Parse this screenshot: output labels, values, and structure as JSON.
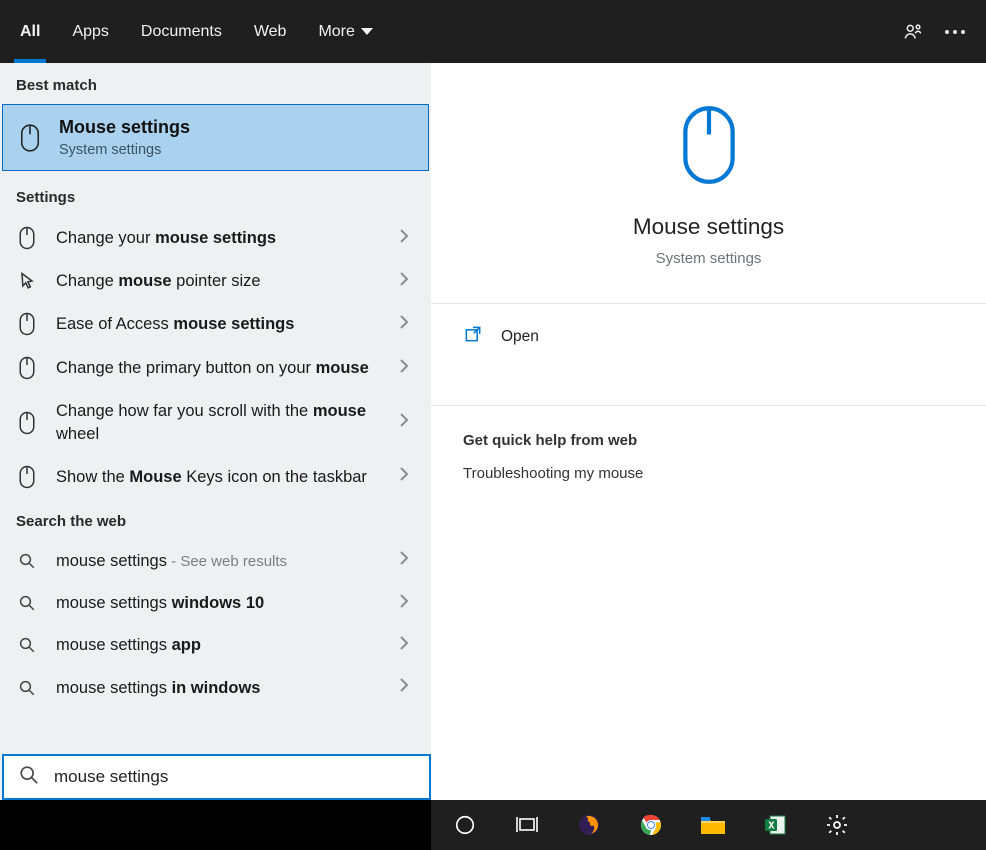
{
  "tabs": {
    "all": "All",
    "apps": "Apps",
    "documents": "Documents",
    "web": "Web",
    "more": "More"
  },
  "sections": {
    "best_match": "Best match",
    "settings": "Settings",
    "search_web": "Search the web"
  },
  "best_match": {
    "title": "Mouse settings",
    "subtitle": "System settings"
  },
  "settings_results": [
    {
      "pre": "Change your ",
      "bold": "mouse settings",
      "post": "",
      "icon": "mouse"
    },
    {
      "pre": "Change ",
      "bold": "mouse",
      "post": " pointer size",
      "icon": "pointer"
    },
    {
      "pre": "Ease of Access ",
      "bold": "mouse settings",
      "post": "",
      "icon": "mouse"
    },
    {
      "pre": "Change the primary button on your ",
      "bold": "mouse",
      "post": "",
      "icon": "mouse"
    },
    {
      "pre": "Change how far you scroll with the ",
      "bold": "mouse",
      "post": " wheel",
      "icon": "mouse"
    },
    {
      "pre": "Show the ",
      "bold": "Mouse",
      "post": " Keys icon on the taskbar",
      "icon": "mouse"
    }
  ],
  "web_results": [
    {
      "pre": "mouse settings",
      "bold": "",
      "post": "",
      "suffix": " - See web results"
    },
    {
      "pre": "mouse settings ",
      "bold": "windows 10",
      "post": ""
    },
    {
      "pre": "mouse settings ",
      "bold": "app",
      "post": ""
    },
    {
      "pre": "mouse settings ",
      "bold": "in windows",
      "post": ""
    }
  ],
  "preview": {
    "title": "Mouse settings",
    "subtitle": "System settings",
    "open": "Open",
    "help_header": "Get quick help from web",
    "help_items": [
      "Troubleshooting my mouse"
    ]
  },
  "search": {
    "value": "mouse settings"
  },
  "colors": {
    "accent": "#0078d4",
    "selection": "#aad2ee"
  }
}
